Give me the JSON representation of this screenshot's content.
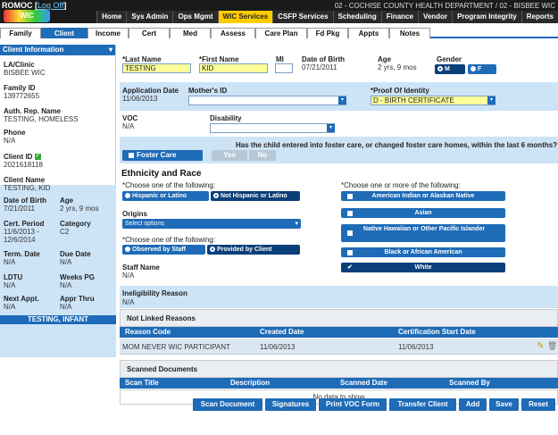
{
  "header": {
    "brand": "ROMOC",
    "logoff": "Log Off",
    "logo_text": "WIC",
    "county": "02 - COCHISE COUNTY HEALTH DEPARTMENT / 02 - BISBEE WIC",
    "nav": [
      "Home",
      "Sys Admin",
      "Ops Mgmt",
      "WIC Services",
      "CSFP Services",
      "Scheduling",
      "Finance",
      "Vendor",
      "Program Integrity",
      "Reports"
    ],
    "active_nav": "WIC Services"
  },
  "tabs": [
    "Family",
    "Client",
    "Income",
    "Cert",
    "Med",
    "Assess",
    "Care Plan",
    "Fd Pkg",
    "Appts",
    "Notes"
  ],
  "active_tab": "Client",
  "sidebar": {
    "head": "Client Information",
    "la_clinic_label": "LA/Clinic",
    "la_clinic": "BISBEE WIC",
    "family_id_label": "Family ID",
    "family_id": "139772655",
    "auth_rep_label": "Auth. Rep. Name",
    "auth_rep": "TESTING, HOMELESS",
    "phone_label": "Phone",
    "phone": "N/A",
    "client_id_label": "Client ID",
    "client_id": "2021618118",
    "client_name_label": "Client Name",
    "client_name": "TESTING, KID",
    "dob_label": "Date of Birth",
    "dob": "7/21/2011",
    "age_label": "Age",
    "age": "2 yrs, 9 mos",
    "cert_period_label": "Cert. Period",
    "cert_period": "11/6/2013 -\n12/6/2014",
    "category_label": "Category",
    "category": "C2",
    "term_date_label": "Term. Date",
    "term_date": "N/A",
    "due_date_label": "Due Date",
    "due_date": "N/A",
    "ldtu_label": "LDTU",
    "ldtu": "N/A",
    "weeks_pg_label": "Weeks PG",
    "weeks_pg": "N/A",
    "next_appt_label": "Next Appt.",
    "next_appt": "N/A",
    "appr_thru_label": "Appr Thru",
    "appr_thru": "N/A",
    "footer": "TESTING, INFANT"
  },
  "form": {
    "last_name_label": "*Last Name",
    "last_name": "TESTING",
    "first_name_label": "*First Name",
    "first_name": "KID",
    "mi_label": "MI",
    "mi": "",
    "dob_label": "Date of Birth",
    "dob": "07/21/2011",
    "age_label": "Age",
    "age": "2 yrs, 9 mos",
    "gender_label": "Gender",
    "gender_m": "M",
    "gender_f": "F",
    "app_date_label": "Application Date",
    "app_date": "11/06/2013",
    "mothers_id_label": "Mother's ID",
    "mothers_id": "",
    "proof_label": "*Proof Of Identity",
    "proof": "D - BIRTH CERTIFICATE",
    "voc_label": "VOC",
    "voc": "N/A",
    "disability_label": "Disability",
    "disability": "",
    "foster_care": "Foster Care",
    "foster_question": "Has the child entered into foster care, or changed foster care homes, within the last 6 months?",
    "yes": "Yes",
    "no": "No",
    "eth_title": "Ethnicity and Race",
    "choose_one": "*Choose one of the following:",
    "hispanic": "Hispanic or Latino",
    "not_hispanic": "Not Hispanic or Latino",
    "origins_label": "Origins",
    "origins_placeholder": "Select options",
    "choose_one2": "*Choose one of the following:",
    "observed": "Observed by Staff",
    "provided": "Provided by Client",
    "staff_name_label": "Staff Name",
    "staff_name": "N/A",
    "choose_more": "*Choose one or more of the following:",
    "races": [
      "American Indian or Alaskan Native",
      "Asian",
      "Native Hawaiian or Other Pacific Islander",
      "Black or African American",
      "White"
    ],
    "inelig_label": "Ineligibility Reason",
    "inelig": "N/A"
  },
  "not_linked": {
    "title": "Not Linked Reasons",
    "headers": [
      "Reason Code",
      "Created Date",
      "Certification Start Date"
    ],
    "rows": [
      [
        "MOM NEVER WIC PARTICIPANT",
        "11/06/2013",
        "11/06/2013"
      ]
    ]
  },
  "scanned": {
    "title": "Scanned Documents",
    "headers": [
      "Scan Title",
      "Description",
      "Scanned Date",
      "Scanned By"
    ],
    "empty": "No data to show"
  },
  "buttons": [
    "Scan Document",
    "Signatures",
    "Print VOC Form",
    "Transfer Client",
    "Add",
    "Save",
    "Reset"
  ],
  "colors": {
    "accent": "#1e6bb8",
    "highlight": "#ffff99",
    "active_nav": "#ffcc00"
  }
}
